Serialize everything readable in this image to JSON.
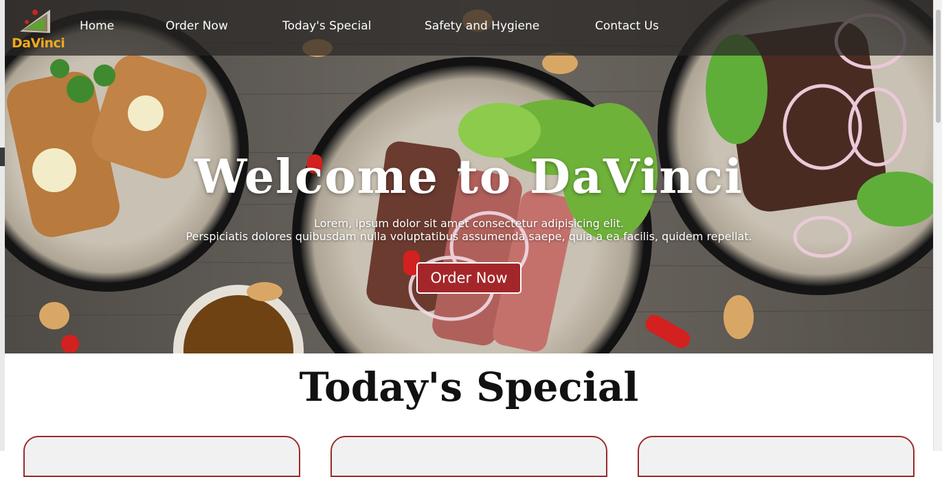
{
  "brand": {
    "logo_text": "DaVinci"
  },
  "nav": {
    "items": [
      "Home",
      "Order Now",
      "Today's Special",
      "Safety and Hygiene",
      "Contact Us"
    ]
  },
  "hero": {
    "title": "Welcome to DaVinci",
    "subtitle_line1": "Lorem, ipsum dolor sit amet consectetur adipisicing elit.",
    "subtitle_line2": "Perspiciatis dolores quibusdam nulla voluptatibus assumenda saepe, quia a ea facilis, quidem repellat.",
    "cta_label": "Order Now"
  },
  "specials": {
    "title": "Today's Special"
  },
  "colors": {
    "accent": "#a3272a",
    "logo": "#f0a91e",
    "nav_bg": "#282624"
  }
}
